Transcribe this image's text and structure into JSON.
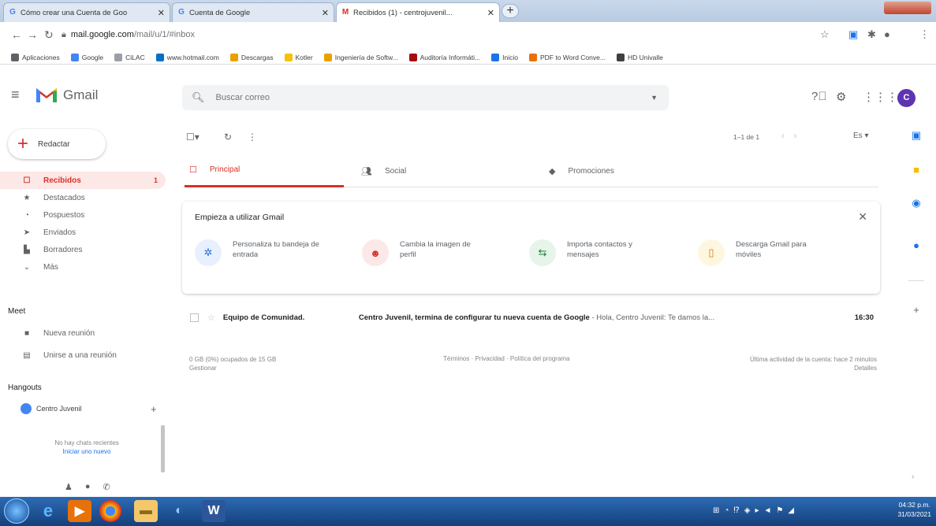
{
  "browser": {
    "tabs": [
      {
        "title": "Cómo crear una Cuenta de Goo",
        "close": "✕"
      },
      {
        "title": "Cuenta de Google",
        "close": "✕"
      },
      {
        "title": "Recibidos (1) - centrojuvenil...",
        "close": "✕"
      }
    ],
    "new_tab": "+",
    "url_host": "mail.google.com",
    "url_path": "/mail/u/1/#inbox",
    "bookmarks": [
      {
        "label": "Aplicaciones",
        "color": "#5f6368"
      },
      {
        "label": "Google",
        "color": "#4285f4"
      },
      {
        "label": "CiLAC",
        "color": "#9aa0a6"
      },
      {
        "label": "www.hotmail.com",
        "color": "#0072c6"
      },
      {
        "label": "Descargas",
        "color": "#e8a200"
      },
      {
        "label": "Kotler",
        "color": "#f4c20d"
      },
      {
        "label": "Ingeniería de Softw...",
        "color": "#e8a200"
      },
      {
        "label": "Auditoría Informáti...",
        "color": "#a50e0e"
      },
      {
        "label": "Inicio",
        "color": "#1a73e8"
      },
      {
        "label": "PDF to Word Conve...",
        "color": "#e8710a"
      },
      {
        "label": "HD Univalle",
        "color": "#3c4043"
      }
    ]
  },
  "gmail": {
    "app_name": "Gmail",
    "search_placeholder": "Buscar correo",
    "avatar_letter": "C",
    "compose_label": "Redactar",
    "nav": [
      {
        "label": "Recibidos",
        "count": "1",
        "icon": "inbox-icon",
        "glyph": "☐",
        "active": true
      },
      {
        "label": "Destacados",
        "count": "",
        "icon": "star-icon",
        "glyph": "★",
        "active": false
      },
      {
        "label": "Pospuestos",
        "count": "",
        "icon": "clock-icon",
        "glyph": "◔",
        "active": false
      },
      {
        "label": "Enviados",
        "count": "",
        "icon": "send-icon",
        "glyph": "➤",
        "active": false
      },
      {
        "label": "Borradores",
        "count": "",
        "icon": "draft-icon",
        "glyph": "▙",
        "active": false
      },
      {
        "label": "Más",
        "count": "",
        "icon": "chevron-down-icon",
        "glyph": "⌄",
        "active": false
      }
    ],
    "meet": {
      "title": "Meet",
      "new_meeting": "Nueva reunión",
      "join_meeting": "Unirse a una reunión"
    },
    "hangouts": {
      "title": "Hangouts",
      "user": "Centro Juvenil",
      "no_chats": "No hay chats recientes",
      "start_new": "Iniciar uno nuevo"
    },
    "toolbar": {
      "pager": "1–1 de 1",
      "lang": "Es"
    },
    "tabs": [
      {
        "label": "Principal"
      },
      {
        "label": "Social"
      },
      {
        "label": "Promociones"
      }
    ],
    "getting_started": {
      "title": "Empieza a utilizar Gmail",
      "items": [
        {
          "text": "Personaliza tu bandeja de entrada",
          "icon": "gear-icon",
          "glyph": "✲",
          "bg": "#e8f0fe",
          "fg": "#1a73e8"
        },
        {
          "text": "Cambia la imagen de perfil",
          "icon": "profile-icon",
          "glyph": "☻",
          "bg": "#fce8e6",
          "fg": "#d93025"
        },
        {
          "text": "Importa contactos y mensajes",
          "icon": "contacts-icon",
          "glyph": "⇆",
          "bg": "#e6f4ea",
          "fg": "#188038"
        },
        {
          "text": "Descarga Gmail para móviles",
          "icon": "phone-icon",
          "glyph": "▯",
          "bg": "#fef7e0",
          "fg": "#e37400"
        }
      ]
    },
    "emails": [
      {
        "sender": "Equipo de Comunidad.",
        "subject": "Centro Juvenil, termina de configurar tu nueva cuenta de Google",
        "snippet": " - Hola, Centro Juvenil: Te damos la...",
        "time": "16:30"
      }
    ],
    "footer": {
      "storage": "0 GB (0%) ocupados de 15 GB",
      "manage": "Gestionar",
      "terms": "Términos · Privacidad · Política del programa",
      "activity": "Última actividad de la cuenta: hace 2 minutos",
      "details": "Detalles"
    }
  },
  "taskbar": {
    "clock_time": "04:32 p.m.",
    "clock_date": "31/03/2021"
  }
}
